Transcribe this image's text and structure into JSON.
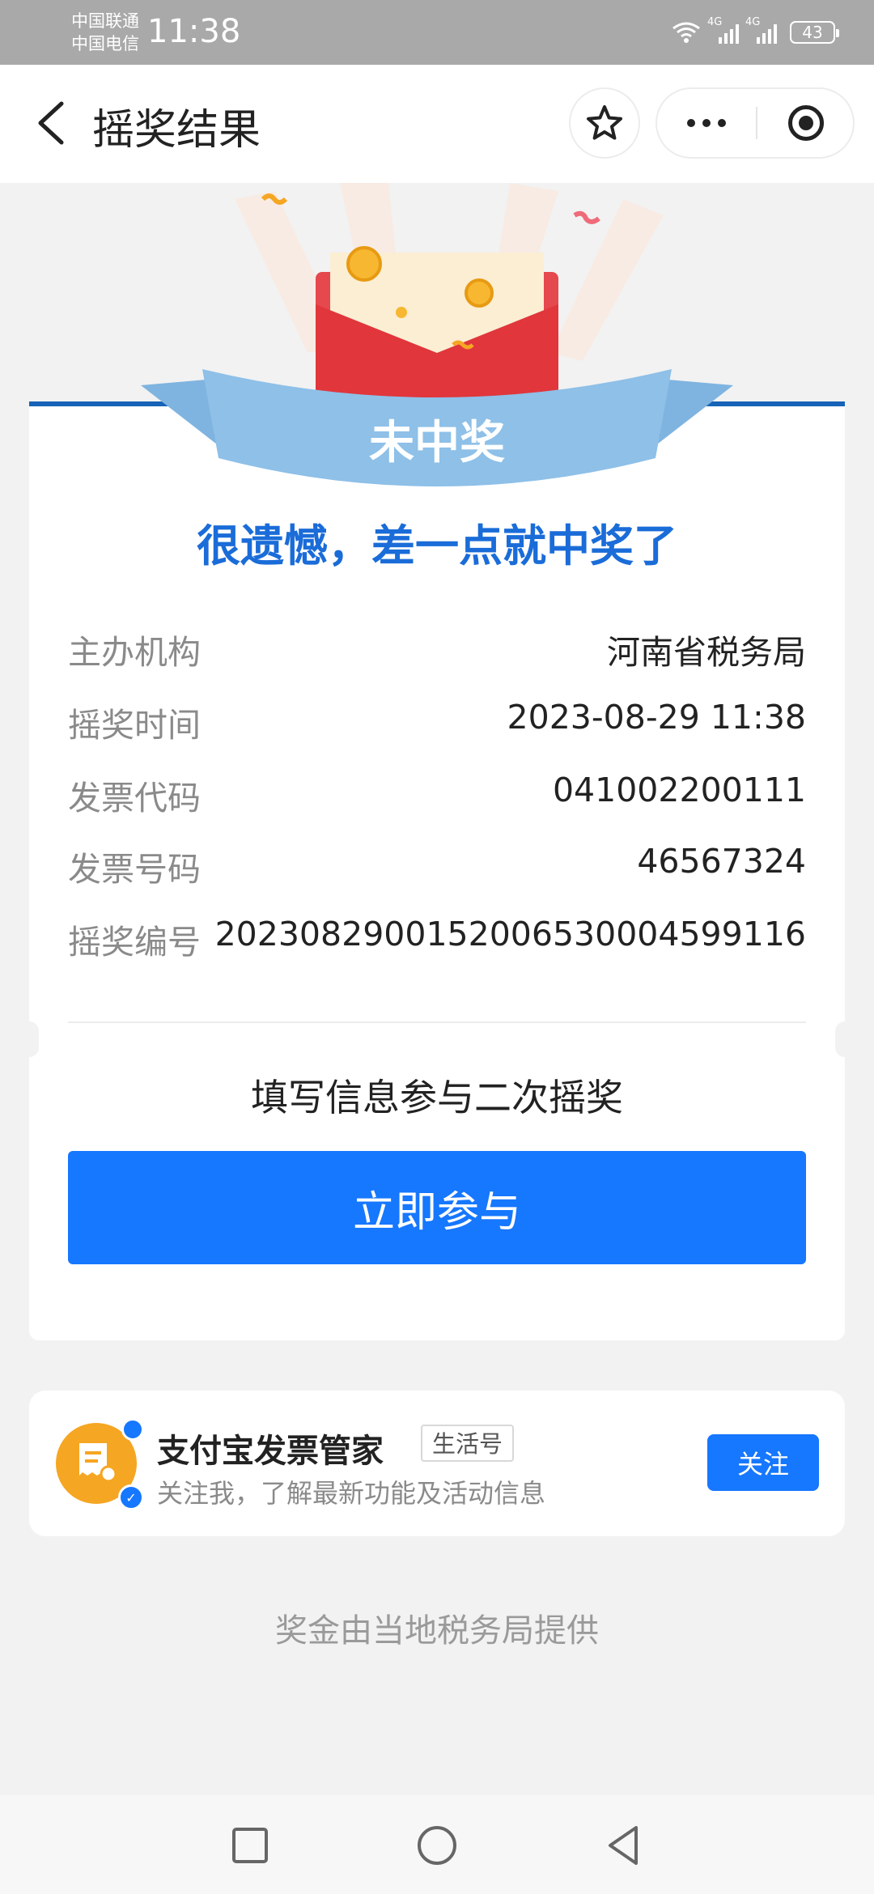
{
  "status_bar": {
    "carrier1": "中国联通",
    "carrier2": "中国电信",
    "time": "11:38",
    "network1": "4G",
    "network2": "4G",
    "battery": "43"
  },
  "nav": {
    "title": "摇奖结果"
  },
  "result": {
    "badge": "未中奖",
    "message": "很遗憾，差一点就中奖了"
  },
  "details": [
    {
      "label": "主办机构",
      "value": "河南省税务局"
    },
    {
      "label": "摇奖时间",
      "value": "2023-08-29 11:38"
    },
    {
      "label": "发票代码",
      "value": "041002200111"
    },
    {
      "label": "发票号码",
      "value": "46567324"
    },
    {
      "label": "摇奖编号",
      "value": "2023082900152006530004599116"
    }
  ],
  "second_draw": {
    "title": "填写信息参与二次摇奖",
    "button": "立即参与"
  },
  "account": {
    "name": "支付宝发票管家",
    "tag": "生活号",
    "desc": "关注我，了解最新功能及活动信息",
    "follow": "关注"
  },
  "footer": "奖金由当地税务局提供",
  "colors": {
    "primary": "#1677ff",
    "banner_blue": "#8ec0e8",
    "message_blue": "#1a6cd8",
    "envelope_red": "#e5484d",
    "avatar_orange": "#f5a623"
  }
}
